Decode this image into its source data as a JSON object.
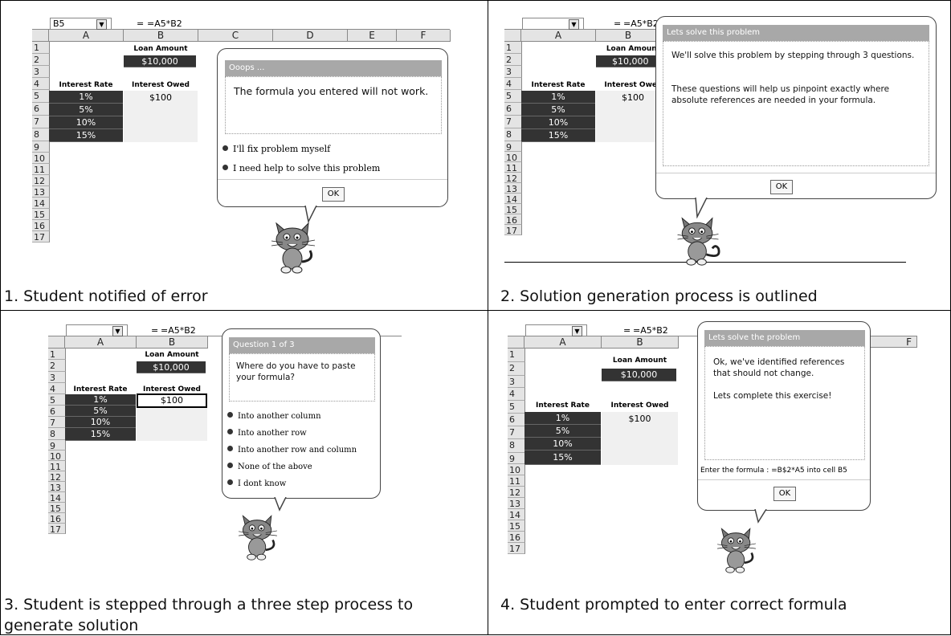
{
  "captions": {
    "p1": "1. Student notified of error",
    "p2": "2. Solution generation process is outlined",
    "p3_line1": "3. Student is stepped through a three step process to",
    "p3_line2": "generate solution",
    "p4": "4. Student prompted to enter correct formula"
  },
  "sheet": {
    "namebox_cell": "B5",
    "formula": "=A5*B2",
    "eq_sign": "=",
    "columns": [
      "A",
      "B",
      "C",
      "D",
      "E",
      "F"
    ],
    "rows": [
      "1",
      "2",
      "3",
      "4",
      "5",
      "6",
      "7",
      "8",
      "9",
      "10",
      "11",
      "12",
      "13",
      "14",
      "15",
      "16",
      "17"
    ],
    "loan_header": "Loan Amount",
    "loan_value": "$10,000",
    "rate_header": "Interest Rate",
    "owed_header": "Interest Owed",
    "rates": [
      "1%",
      "5%",
      "10%",
      "15%"
    ],
    "owed_first": "$100"
  },
  "panel1": {
    "dialog_title": "Ooops ...",
    "message": "The formula you entered will not work.",
    "options": [
      "I'll fix problem myself",
      "I need help to solve this problem"
    ],
    "ok": "OK"
  },
  "panel2": {
    "dialog_title": "Lets solve this problem",
    "message1": "We'll solve this problem by stepping through 3 questions.",
    "message2": "These questions will help us pinpoint exactly where absolute references are needed in your formula.",
    "ok": "OK",
    "owed_header_trunc": "Interest Owe",
    "loan_header_trunc": "Loan Amount"
  },
  "panel3": {
    "dialog_title": "Question 1 of 3",
    "message": "Where do you have to paste your formula?",
    "options": [
      "Into another column",
      "Into another row",
      "Into another row and column",
      "None of the above",
      "I dont know"
    ]
  },
  "panel4": {
    "dialog_title": "Lets solve the problem",
    "message1": "Ok, we've identified references that should not change.",
    "message2": "Lets complete this exercise!",
    "instruction": "Enter the formula : =B$2*A5 into cell B5",
    "ok": "OK"
  },
  "icons": [
    "cat-mascot-icon",
    "dropdown-arrow-icon",
    "bullet-icon"
  ]
}
